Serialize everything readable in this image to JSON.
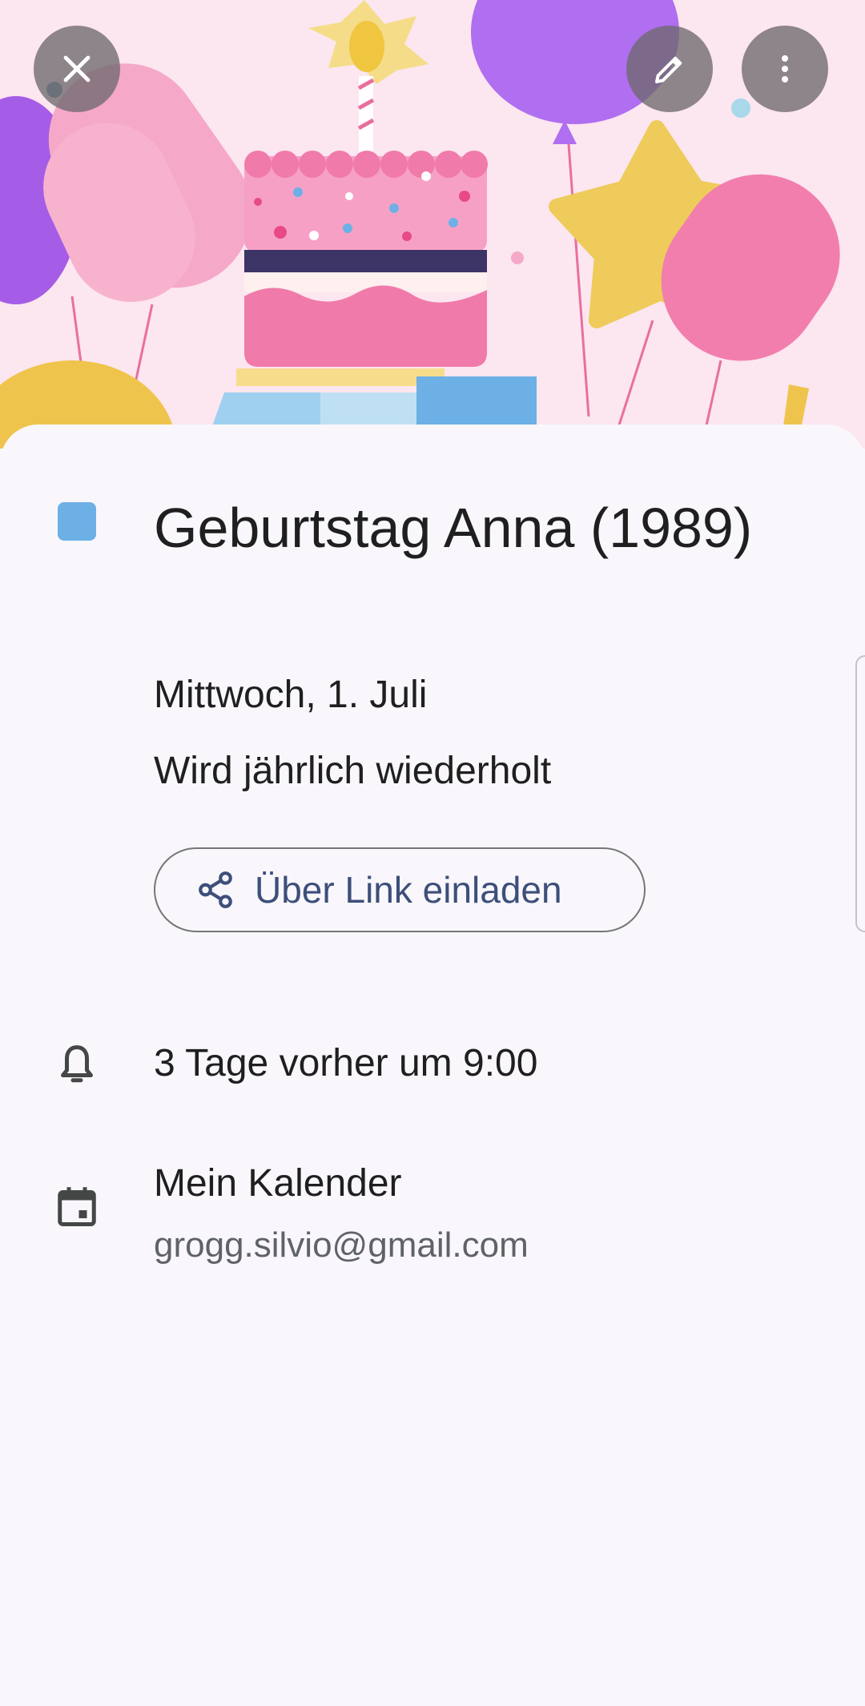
{
  "event": {
    "title": "Geburtstag Anna (1989)",
    "date": "Mittwoch, 1. Juli",
    "recurrence": "Wird jährlich wiederholt",
    "color": "#6cb0e6"
  },
  "actions": {
    "invite_label": "Über Link einladen"
  },
  "reminder": {
    "text": "3 Tage vorher um 9:00"
  },
  "calendar": {
    "name": "Mein Kalender",
    "account": "grogg.silvio@gmail.com"
  },
  "icons": {
    "close": "close-icon",
    "edit": "pencil-icon",
    "more": "more-vert-icon",
    "share": "share-icon",
    "bell": "bell-icon",
    "calendar": "calendar-icon"
  }
}
